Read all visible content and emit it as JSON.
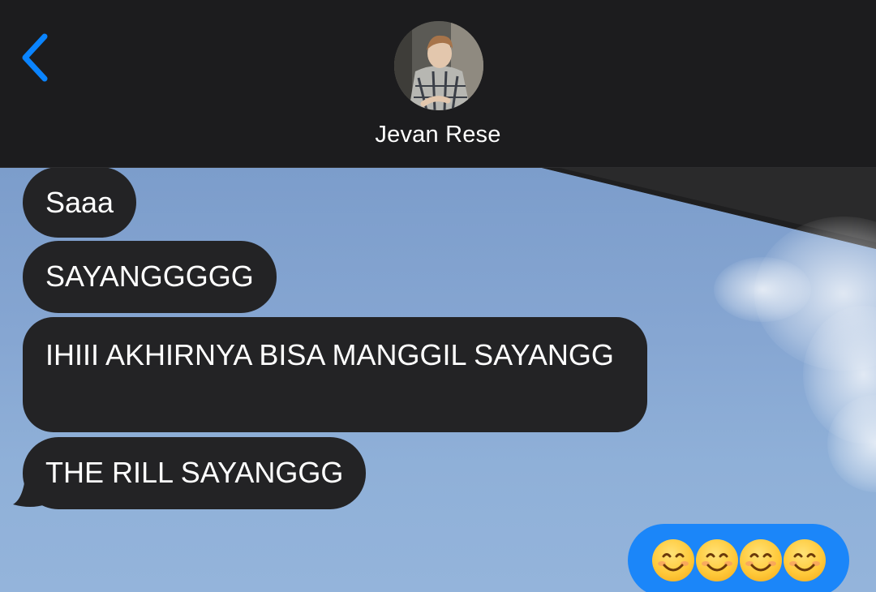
{
  "header": {
    "contact_name": "Jevan Rese",
    "back_icon": "chevron-left-icon",
    "accent_color": "#0a84ff"
  },
  "messages": {
    "received": [
      {
        "text": "Saaa"
      },
      {
        "text": "SAYANGGGGG"
      },
      {
        "text": "IHIII AKHIRNYA BISA MANGGIL SAYANGG"
      },
      {
        "text": "THE RILL SAYANGGG"
      }
    ],
    "sent": [
      {
        "text": "😊😊😊😊",
        "emoji_count": 4,
        "emoji_name": "smiling-face-with-smiling-eyes"
      }
    ]
  },
  "colors": {
    "header_bg": "#1c1c1e",
    "received_bubble": "#232325",
    "sent_bubble": "#1b86f9"
  }
}
